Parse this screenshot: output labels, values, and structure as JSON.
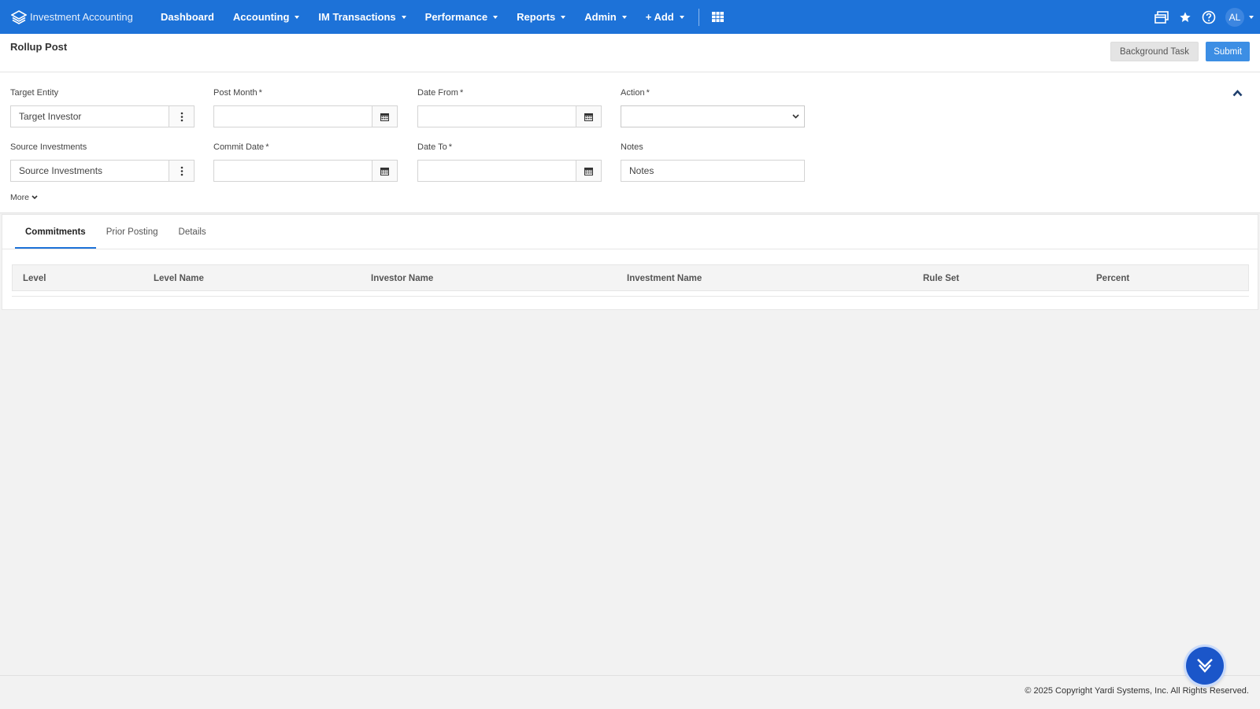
{
  "app": {
    "brand": "Investment Accounting",
    "nav": [
      {
        "label": "Dashboard",
        "caret": false
      },
      {
        "label": "Accounting",
        "caret": true
      },
      {
        "label": "IM Transactions",
        "caret": true
      },
      {
        "label": "Performance",
        "caret": true
      },
      {
        "label": "Reports",
        "caret": true
      },
      {
        "label": "Admin",
        "caret": true
      },
      {
        "label": "+ Add",
        "caret": true
      }
    ],
    "user_initials": "AL"
  },
  "page": {
    "title": "Rollup Post",
    "background_task_label": "Background Task",
    "submit_label": "Submit"
  },
  "filters": {
    "target_entity": {
      "label": "Target Entity",
      "value": "Target Investor"
    },
    "source_investments": {
      "label": "Source Investments",
      "value": "Source Investments"
    },
    "post_month": {
      "label": "Post Month",
      "required": "*",
      "value": ""
    },
    "commit_date": {
      "label": "Commit Date",
      "required": "*",
      "value": ""
    },
    "date_from": {
      "label": "Date From",
      "required": "*",
      "value": ""
    },
    "date_to": {
      "label": "Date To",
      "required": "*",
      "value": ""
    },
    "action": {
      "label": "Action",
      "required": "*",
      "value": ""
    },
    "notes": {
      "label": "Notes",
      "value": "Notes"
    },
    "more_label": "More"
  },
  "tabs": {
    "items": [
      "Commitments",
      "Prior Posting",
      "Details"
    ],
    "active": "Commitments"
  },
  "grid": {
    "columns": [
      "Level",
      "Level Name",
      "Investor Name",
      "Investment Name",
      "Rule Set",
      "Percent"
    ]
  },
  "footer": {
    "copyright": "© 2025 Copyright Yardi Systems, Inc. All Rights Reserved."
  },
  "colors": {
    "nav_bg": "#1d72d8",
    "submit_bg": "#3c8ee4",
    "fab_bg": "#1b56c9"
  }
}
